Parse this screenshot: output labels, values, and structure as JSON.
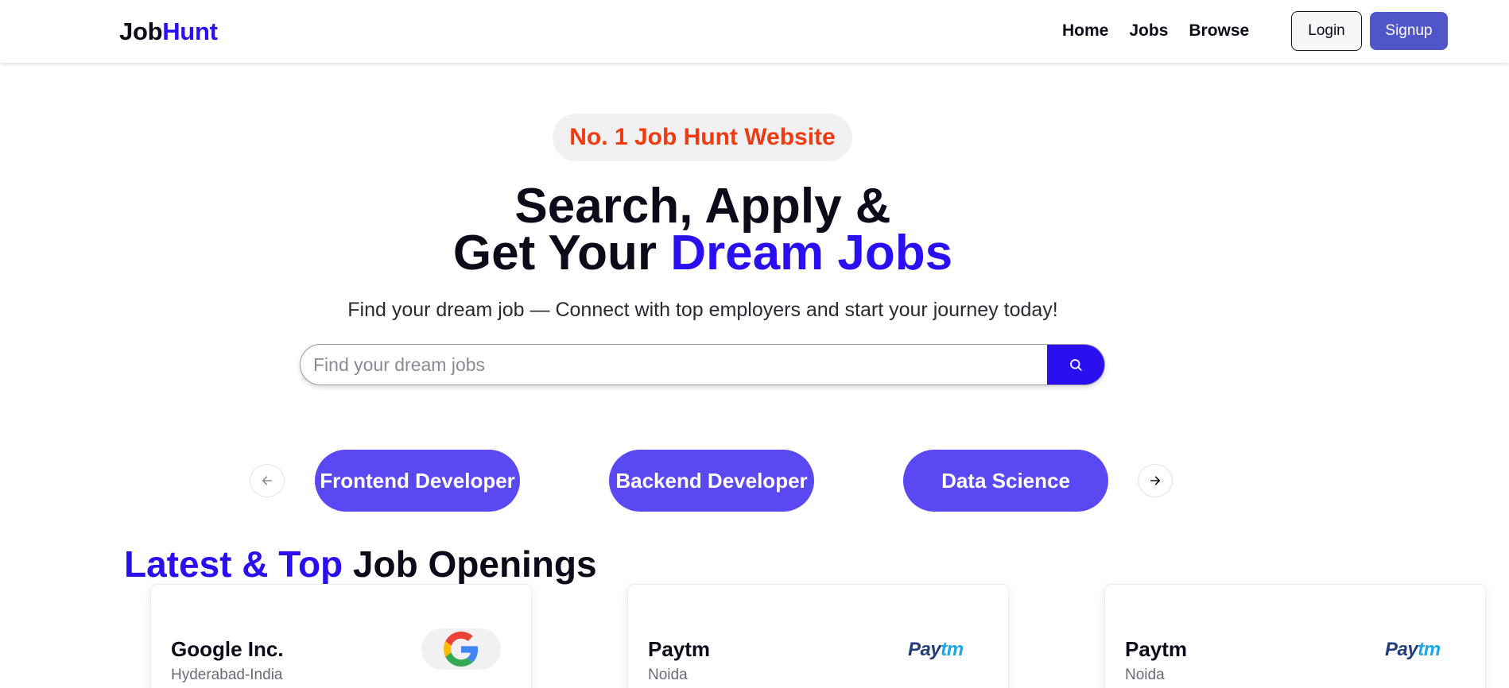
{
  "brand": {
    "part1": "Job",
    "part2": "Hunt"
  },
  "nav": {
    "links": [
      "Home",
      "Jobs",
      "Browse"
    ],
    "login": "Login",
    "signup": "Signup"
  },
  "hero": {
    "badge": "No. 1 Job Hunt Website",
    "headline_line1": "Search, Apply &",
    "headline_line2_prefix": "Get Your ",
    "headline_line2_accent": "Dream Jobs",
    "subtitle": "Find your dream job — Connect with top employers and start your journey today!",
    "search_placeholder": "Find your dream jobs"
  },
  "categories": [
    "Frontend Developer",
    "Backend Developer",
    "Data Science"
  ],
  "latest": {
    "title_accent": "Latest & Top",
    "title_rest": " Job Openings",
    "jobs": [
      {
        "company": "Google Inc.",
        "location": "Hyderabad-India",
        "logo": "google-logo"
      },
      {
        "company": "Paytm",
        "location": "Noida",
        "logo": "paytm-logo"
      },
      {
        "company": "Paytm",
        "location": "Noida",
        "logo": "paytm-logo"
      }
    ],
    "paytm_text_a": "Pay",
    "paytm_text_b": "tm"
  },
  "colors": {
    "accent": "#2a0ff0",
    "badge_red": "#f23a10",
    "category_purple": "#5a48f2",
    "signup": "#5055c8"
  }
}
